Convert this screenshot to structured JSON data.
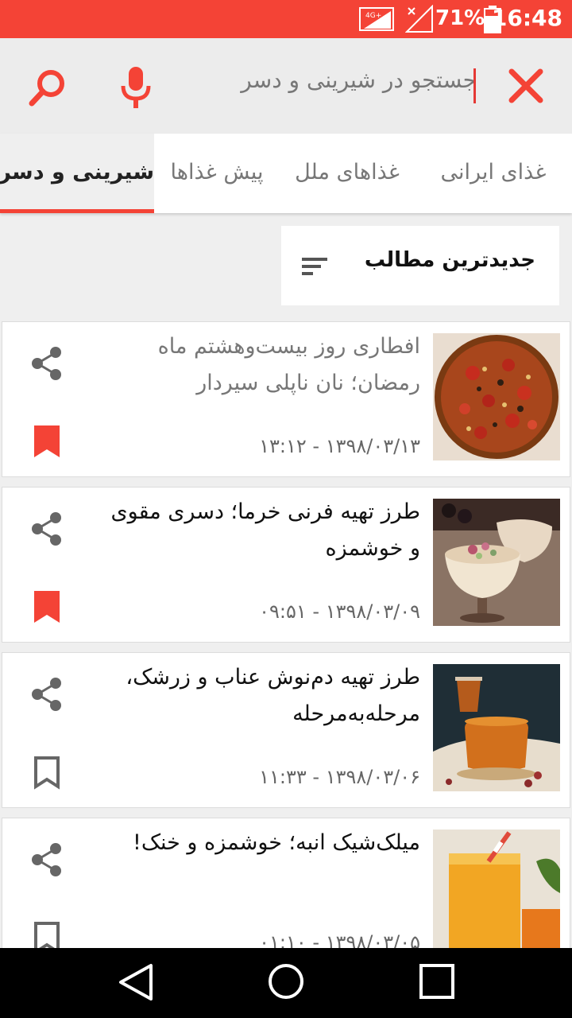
{
  "status_bar": {
    "network": "4G+",
    "battery": "71%",
    "time": "16:48"
  },
  "search": {
    "query": "جستجو در شیرینی و دسر"
  },
  "tabs": [
    {
      "label": "غذای ایرانی",
      "active": false
    },
    {
      "label": "غذاهای ملل",
      "active": false
    },
    {
      "label": "پیش غذاها",
      "active": false
    },
    {
      "label": "شیرینی و دسر",
      "active": true
    }
  ],
  "sort": {
    "label": "جدیدترین مطالب"
  },
  "articles": [
    {
      "title": "افطاری روز بیست‌وهشتم ماه رمضان؛ نان ناپلی سیردار",
      "date": "۱۳۹۸/۰۳/۱۳ - ۱۳:۱۲",
      "read": true,
      "bookmarked": true,
      "image": "pizza-photo"
    },
    {
      "title": "طرز تهیه فرنی خرما؛ دسری مقوی و خوشمزه",
      "date": "۱۳۹۸/۰۳/۰۹ - ۰۹:۵۱",
      "read": false,
      "bookmarked": true,
      "image": "date-pudding-photo"
    },
    {
      "title": "طرز تهیه دم‌نوش عناب و زرشک، مرحله‌به‌مرحله",
      "date": "۱۳۹۸/۰۳/۰۶ - ۱۱:۳۳",
      "read": false,
      "bookmarked": false,
      "image": "herbal-tea-photo"
    },
    {
      "title": "میلک‌شیک انبه؛ خوشمزه و خنک!",
      "date": "۱۳۹۸/۰۳/۰۵ - ۰۱:۱۰",
      "read": false,
      "bookmarked": false,
      "image": "mango-milkshake-photo"
    }
  ],
  "colors": {
    "accent": "#f44336",
    "background": "#efefef"
  }
}
